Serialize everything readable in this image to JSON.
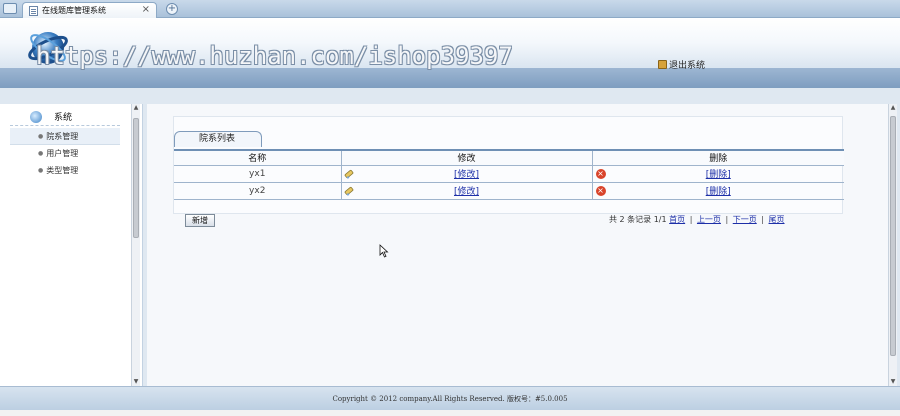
{
  "browser": {
    "tab_title": "在线题库管理系统",
    "tab_close": "×",
    "new_tab": "+"
  },
  "header": {
    "watermark": "https://www.huzhan.com/ishop39397",
    "logout_label": "退出系统"
  },
  "sidebar": {
    "section_label": "系统",
    "items": [
      {
        "label": "院系管理",
        "active": true
      },
      {
        "label": "用户管理",
        "active": false
      },
      {
        "label": "类型管理",
        "active": false
      }
    ]
  },
  "main": {
    "panel_tab": "院系列表",
    "columns": [
      "名称",
      "修改",
      "删除"
    ],
    "rows": [
      {
        "name": "yx1",
        "edit": "[修改]",
        "delete": "[删除]"
      },
      {
        "name": "yx2",
        "edit": "[修改]",
        "delete": "[删除]"
      }
    ],
    "add_button": "新增",
    "pager": {
      "summary": "共 2 条记录 1/1",
      "first": "首页",
      "prev": "上一页",
      "next": "下一页",
      "last": "尾页",
      "sep": "|"
    }
  },
  "footer": {
    "copyright": "Copyright © 2012 company.All Rights Reserved. 版权号：#5.0.005"
  },
  "colors": {
    "accent": "#6e8fb4",
    "link": "#1d2fa8",
    "delete": "#d9442b"
  }
}
